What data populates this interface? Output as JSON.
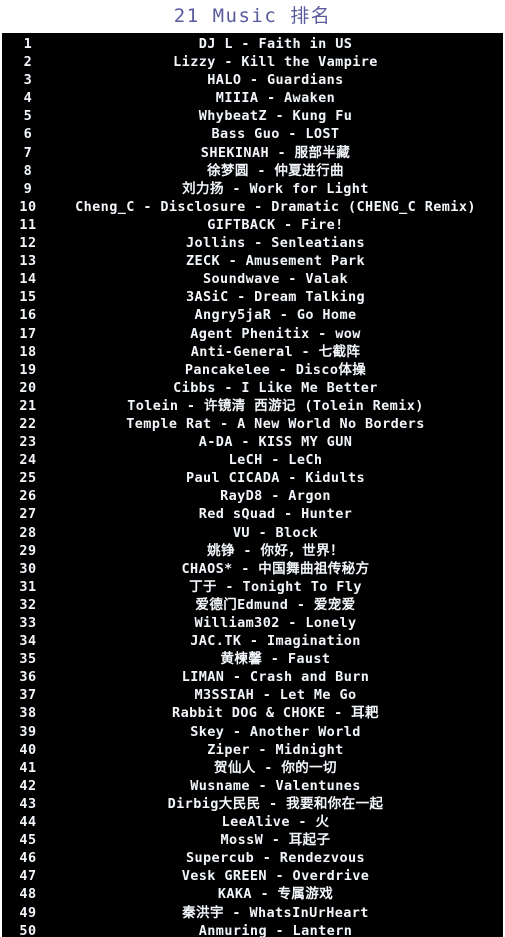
{
  "header": {
    "title": "21 Music 排名",
    "title_color": "#5b5a9e",
    "background_color": "#ffffff"
  },
  "list": {
    "background_color": "#000000",
    "text_color": "#f2f6fb",
    "columns": [
      "rank",
      "track"
    ],
    "rows": [
      {
        "rank": "1",
        "track": "DJ L - Faith in US"
      },
      {
        "rank": "2",
        "track": "Lizzy - Kill the Vampire"
      },
      {
        "rank": "3",
        "track": "HALO - Guardians"
      },
      {
        "rank": "4",
        "track": "MIIIA - Awaken"
      },
      {
        "rank": "5",
        "track": "WhybeatZ - Kung Fu"
      },
      {
        "rank": "6",
        "track": "Bass Guo - LOST"
      },
      {
        "rank": "7",
        "track": "SHEKINAH - 服部半藏"
      },
      {
        "rank": "8",
        "track": "徐梦圆 - 仲夏进行曲"
      },
      {
        "rank": "9",
        "track": "刘力扬 - Work for Light"
      },
      {
        "rank": "10",
        "track": "Cheng_C - Disclosure - Dramatic (CHENG_C Remix)"
      },
      {
        "rank": "11",
        "track": "GIFTBACK - Fire!"
      },
      {
        "rank": "12",
        "track": "Jollins - Senleatians"
      },
      {
        "rank": "13",
        "track": "ZECK - Amusement Park"
      },
      {
        "rank": "14",
        "track": "Soundwave - Valak"
      },
      {
        "rank": "15",
        "track": "3ASiC - Dream Talking"
      },
      {
        "rank": "16",
        "track": "Angry5jaR - Go Home"
      },
      {
        "rank": "17",
        "track": "Agent Phenitix - wow"
      },
      {
        "rank": "18",
        "track": "Anti-General - 七截阵"
      },
      {
        "rank": "19",
        "track": "Pancakelee - Disco体操"
      },
      {
        "rank": "20",
        "track": "Cibbs - I Like Me Better"
      },
      {
        "rank": "21",
        "track": "Tolein - 许镜清 西游记 (Tolein Remix)"
      },
      {
        "rank": "22",
        "track": "Temple Rat - A New World No Borders"
      },
      {
        "rank": "23",
        "track": "A-DA - KISS MY GUN"
      },
      {
        "rank": "24",
        "track": "LeCH - LeCh"
      },
      {
        "rank": "25",
        "track": "Paul CICADA - Kidults"
      },
      {
        "rank": "26",
        "track": "RayD8 - Argon"
      },
      {
        "rank": "27",
        "track": "Red sQuad - Hunter"
      },
      {
        "rank": "28",
        "track": "VU - Block"
      },
      {
        "rank": "29",
        "track": "姚铮 - 你好，世界！"
      },
      {
        "rank": "30",
        "track": "CHAOS* - 中国舞曲祖传秘方"
      },
      {
        "rank": "31",
        "track": "丁于 - Tonight To Fly"
      },
      {
        "rank": "32",
        "track": "爱德门Edmund - 爱宠爱"
      },
      {
        "rank": "33",
        "track": "William302 - Lonely"
      },
      {
        "rank": "34",
        "track": "JAC.TK - Imagination"
      },
      {
        "rank": "35",
        "track": "黄楝馨 - Faust"
      },
      {
        "rank": "36",
        "track": "LIMAN - Crash and Burn"
      },
      {
        "rank": "37",
        "track": "M3SSIAH - Let Me Go"
      },
      {
        "rank": "38",
        "track": "Rabbit DOG & CHOKE - 耳耙"
      },
      {
        "rank": "39",
        "track": "Skey - Another World"
      },
      {
        "rank": "40",
        "track": "Ziper - Midnight"
      },
      {
        "rank": "41",
        "track": "贺仙人 - 你的一切"
      },
      {
        "rank": "42",
        "track": "Wusname - Valentunes"
      },
      {
        "rank": "43",
        "track": "Dirbig大民民 - 我要和你在一起"
      },
      {
        "rank": "44",
        "track": "LeeAlive - 火"
      },
      {
        "rank": "45",
        "track": "MossW - 耳起子"
      },
      {
        "rank": "46",
        "track": "Supercub - Rendezvous"
      },
      {
        "rank": "47",
        "track": "Vesk GREEN - Overdrive"
      },
      {
        "rank": "48",
        "track": "KAKA - 专属游戏"
      },
      {
        "rank": "49",
        "track": "秦洪宇 - WhatsInUrHeart"
      },
      {
        "rank": "50",
        "track": "Anmuring - Lantern"
      }
    ]
  }
}
